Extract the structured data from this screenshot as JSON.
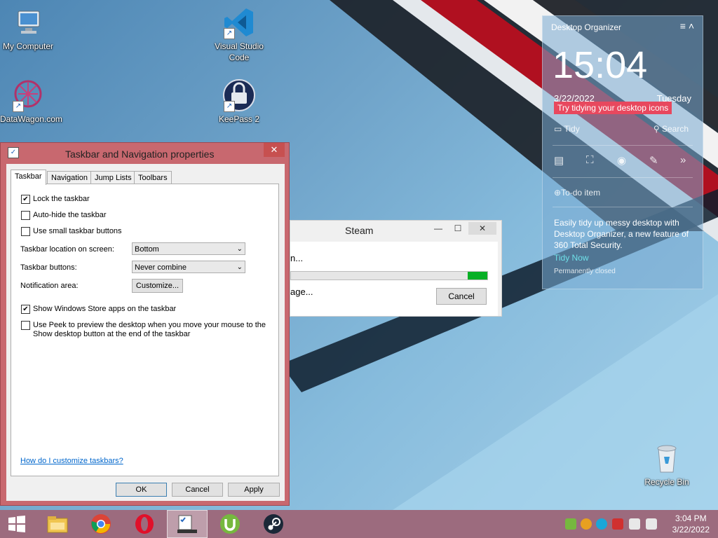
{
  "desktop": {
    "icons": [
      {
        "label": "My Computer",
        "icon": "computer-icon"
      },
      {
        "label": "DataWagon.com",
        "icon": "datawagon-icon"
      },
      {
        "label": "Visual Studio Code",
        "icon": "vscode-icon"
      },
      {
        "label": "KeePass 2",
        "icon": "keepass-icon"
      },
      {
        "label": "Recycle Bin",
        "icon": "recycle-bin-icon"
      }
    ]
  },
  "dialog": {
    "title": "Taskbar and Navigation properties",
    "close": "✕",
    "tabs": [
      "Taskbar",
      "Navigation",
      "Jump Lists",
      "Toolbars"
    ],
    "selected_tab": "Taskbar",
    "lock_taskbar": {
      "label": "Lock the taskbar",
      "checked": "✔"
    },
    "auto_hide": {
      "label": "Auto-hide the taskbar",
      "checked": ""
    },
    "small_buttons": {
      "label": "Use small taskbar buttons",
      "checked": ""
    },
    "location": {
      "label": "Taskbar location on screen:",
      "value": "Bottom"
    },
    "buttons": {
      "label": "Taskbar buttons:",
      "value": "Never combine"
    },
    "notification": {
      "label": "Notification area:",
      "button": "Customize..."
    },
    "store_apps": {
      "label": "Show Windows Store apps on the taskbar",
      "checked": "✔"
    },
    "peek": {
      "label_line1": "Use Peek to preview the desktop when you move your mouse to the",
      "label_line2": "Show desktop button at the end of the taskbar",
      "checked": ""
    },
    "help_link": "How do I customize taskbars?",
    "ok": "OK",
    "cancel": "Cancel",
    "apply": "Apply"
  },
  "steam": {
    "title": "Steam",
    "line1": "n...",
    "line2": "age...",
    "progress": 0.1,
    "cancel": "Cancel",
    "minimize": "—",
    "maximize": "☐",
    "close": "✕"
  },
  "organizer": {
    "title": "Desktop Organizer",
    "time": "15:04",
    "date": "3/22/2022",
    "day": "Tuesday",
    "tip": "Try tidying your desktop icons",
    "tidy": "Tidy",
    "search": "Search",
    "todo": "To-do item",
    "promo": "Easily tidy up messy desktop with Desktop Organizer, a new feature of 360 Total Security.",
    "tidy_now": "Tidy Now",
    "permanently_closed": "Permanently closed"
  },
  "taskbar": {
    "apps": [
      "start-icon",
      "file-explorer-icon",
      "chrome-icon",
      "opera-icon",
      "taskbar-properties-icon",
      "utorrent-icon",
      "steam-icon"
    ],
    "time": "3:04 PM",
    "date": "3/22/2022"
  },
  "colors": {
    "titlebar": "#c8686f",
    "taskbar": "#9c6b7e",
    "progress": "#06b025",
    "tip": "#e8485e"
  }
}
